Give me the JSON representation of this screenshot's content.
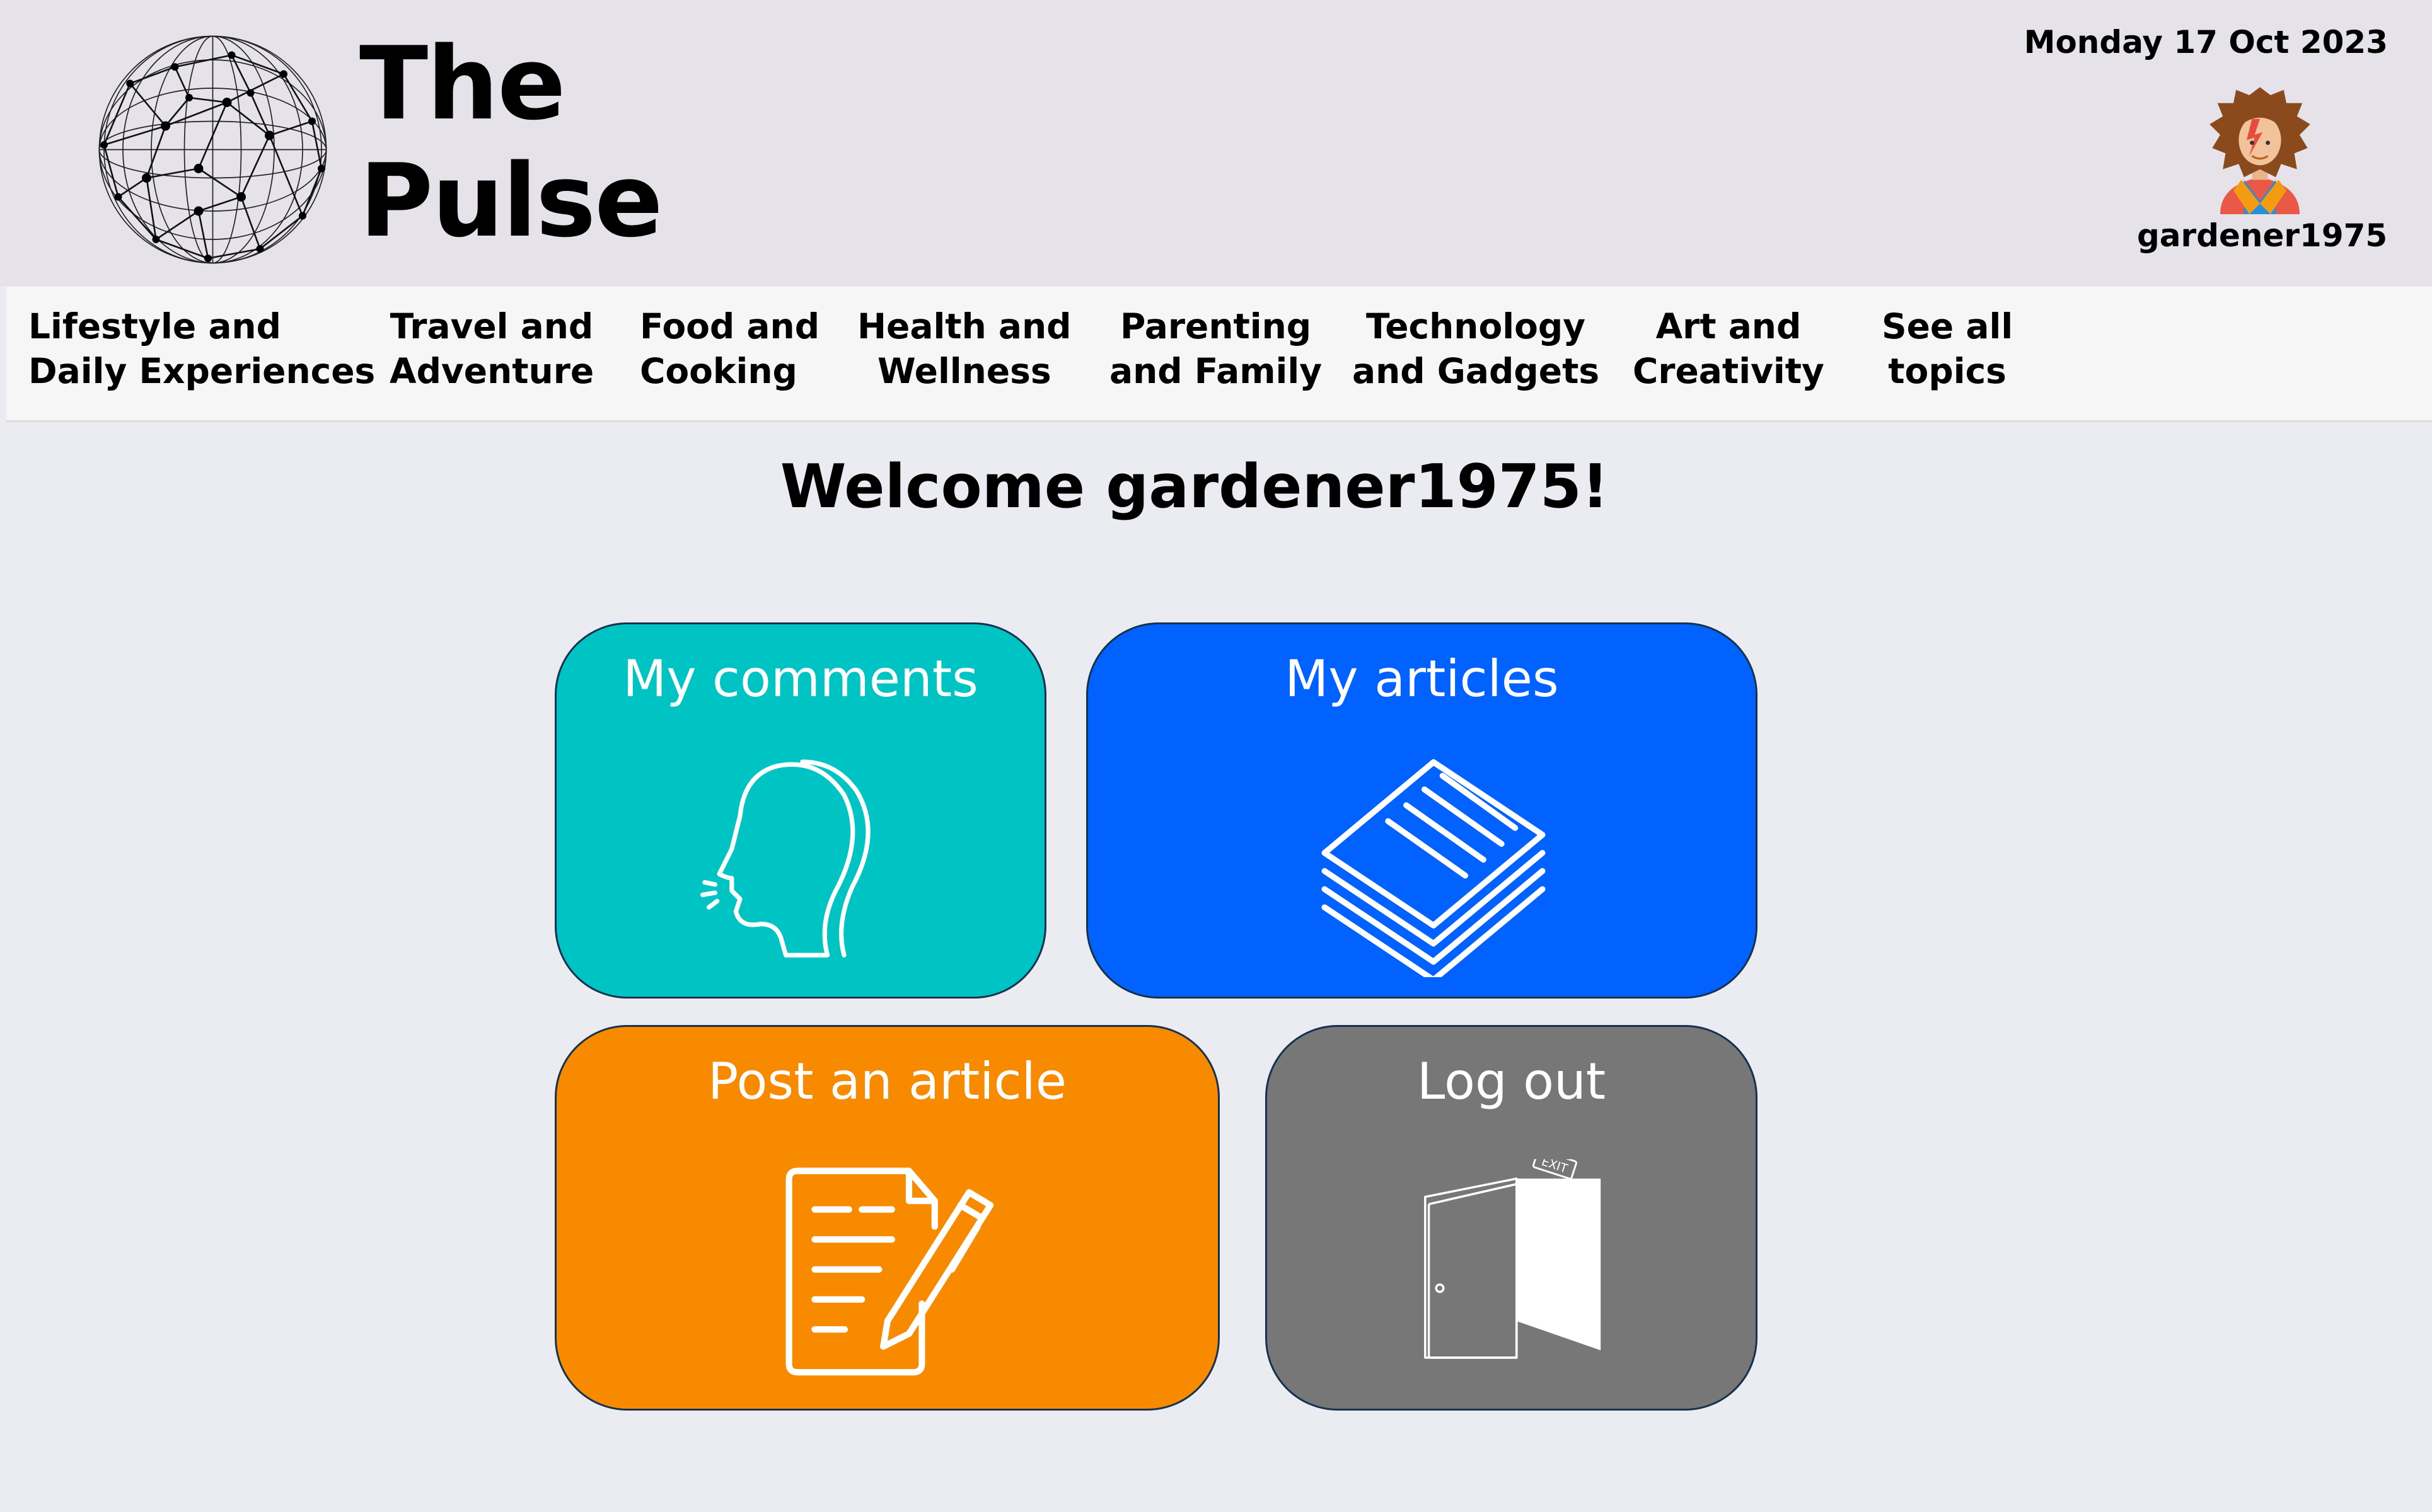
{
  "header": {
    "brand_line1": "The",
    "brand_line2": "Pulse",
    "date": "Monday 17 Oct 2023",
    "username": "gardener1975",
    "logo_icon": "globe-network-icon",
    "avatar_icon": "user-avatar-icon"
  },
  "nav": {
    "items": [
      {
        "line1": "Lifestyle and",
        "line2": "Daily Experiences"
      },
      {
        "line1": "Travel and",
        "line2": "Adventure"
      },
      {
        "line1": "Food and",
        "line2": "Cooking"
      },
      {
        "line1": "Health and",
        "line2": "Wellness"
      },
      {
        "line1": "Parenting",
        "line2": "and Family"
      },
      {
        "line1": "Technology",
        "line2": "and Gadgets"
      },
      {
        "line1": "Art and",
        "line2": "Creativity"
      },
      {
        "line1": "See all",
        "line2": "topics"
      }
    ]
  },
  "main": {
    "welcome": "Welcome gardener1975!",
    "cards": [
      {
        "title": "My comments",
        "icon": "speaking-head-icon",
        "color": "#00c3c3"
      },
      {
        "title": "My articles",
        "icon": "stacked-papers-icon",
        "color": "#0262ff"
      },
      {
        "title": "Post an article",
        "icon": "document-pencil-icon",
        "color": "#f88a00"
      },
      {
        "title": "Log out",
        "icon": "exit-door-icon",
        "color": "#777777"
      }
    ],
    "exit_sign": "EXIT"
  }
}
